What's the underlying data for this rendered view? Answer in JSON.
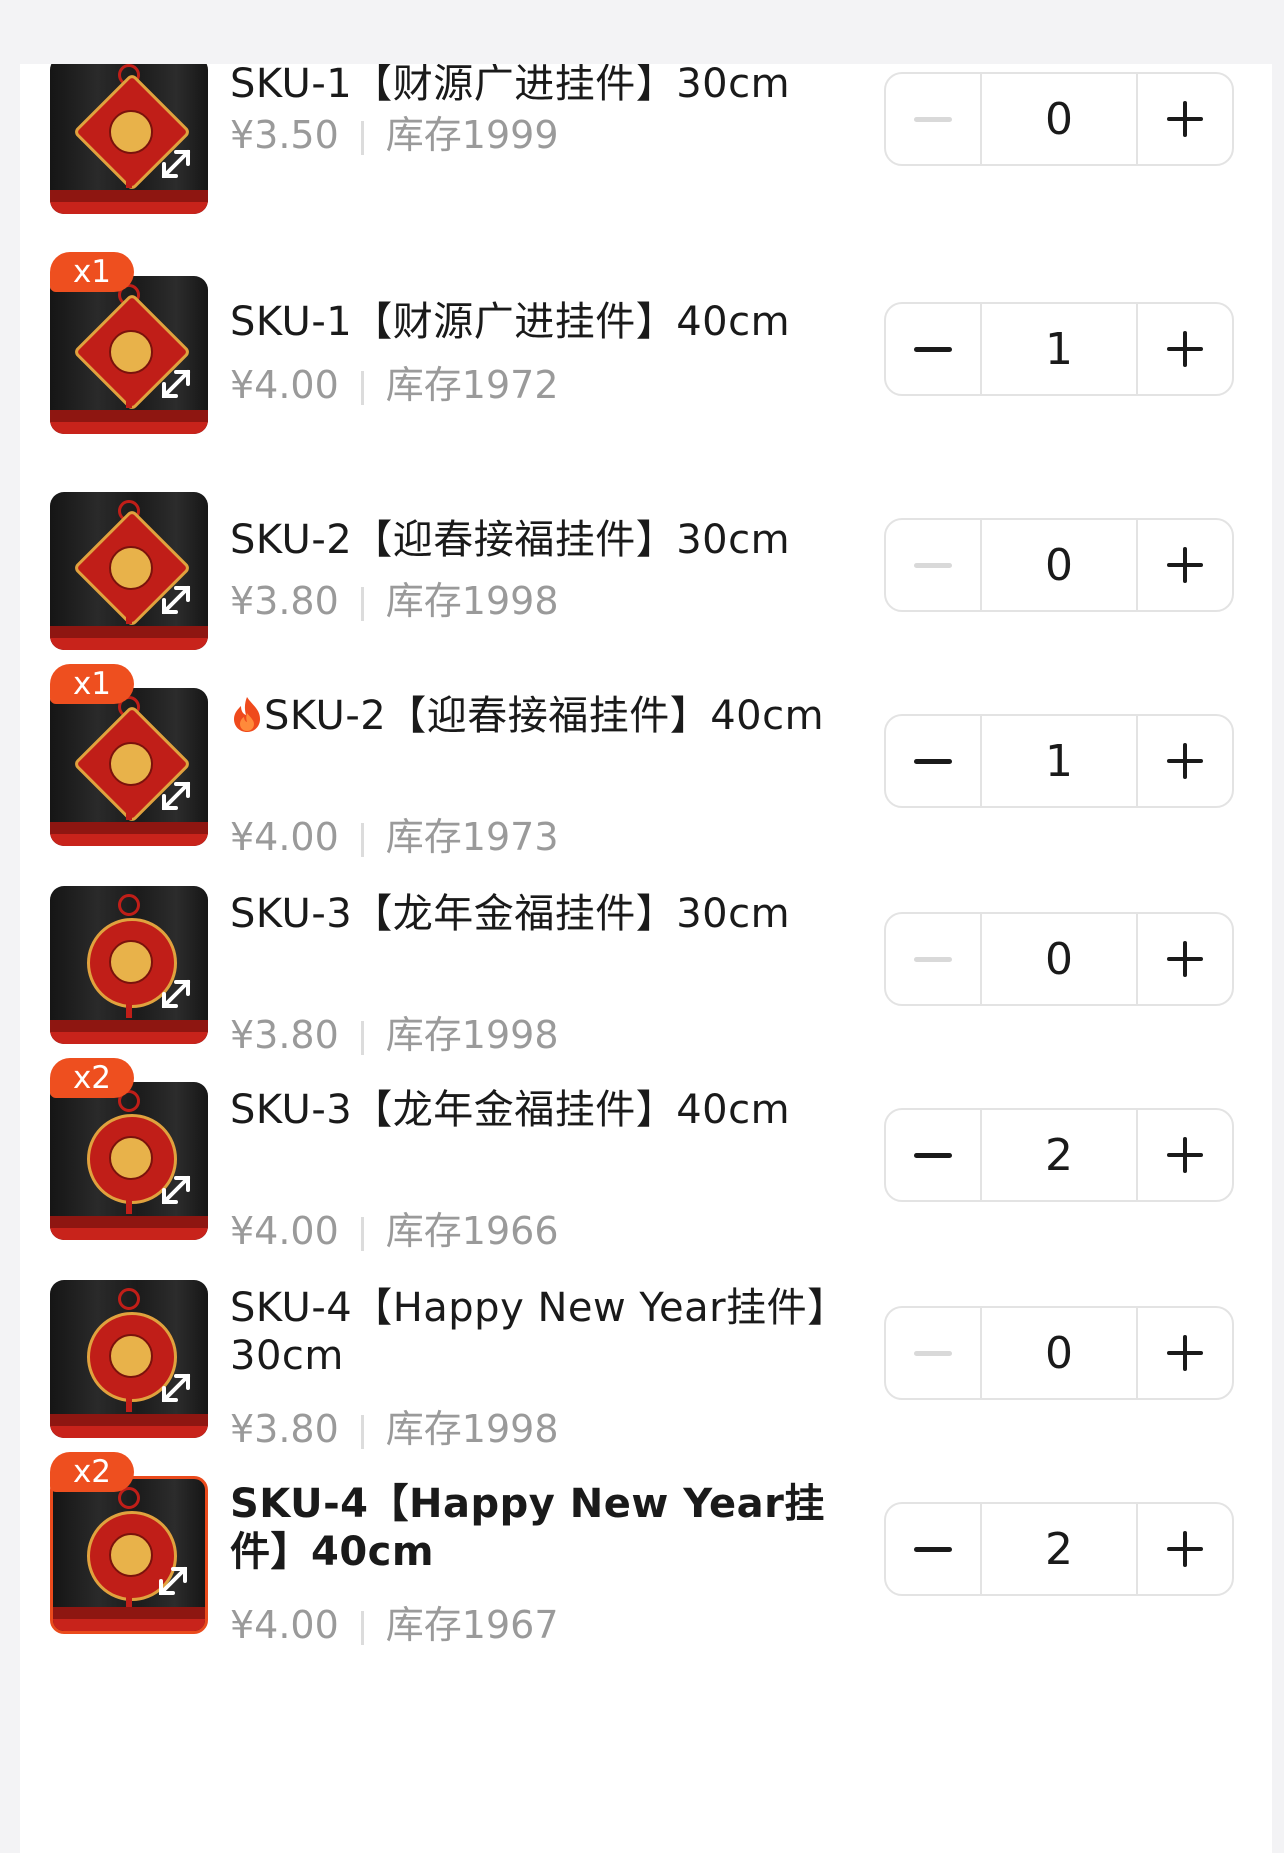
{
  "items": [
    {
      "title": "SKU-1【财源广进挂件】30cm",
      "price": "¥3.50",
      "stock": "库存1999",
      "qty": "0",
      "badge": "",
      "hot": false,
      "style": "diamond",
      "selected": false
    },
    {
      "title": "SKU-1【财源广进挂件】40cm",
      "price": "¥4.00",
      "stock": "库存1972",
      "qty": "1",
      "badge": "x1",
      "hot": false,
      "style": "diamond",
      "selected": false
    },
    {
      "title": "SKU-2【迎春接福挂件】30cm",
      "price": "¥3.80",
      "stock": "库存1998",
      "qty": "0",
      "badge": "",
      "hot": false,
      "style": "diamond",
      "selected": false
    },
    {
      "title": "SKU-2【迎春接福挂件】40cm",
      "price": "¥4.00",
      "stock": "库存1973",
      "qty": "1",
      "badge": "x1",
      "hot": true,
      "style": "diamond",
      "selected": false
    },
    {
      "title": "SKU-3【龙年金福挂件】30cm",
      "price": "¥3.80",
      "stock": "库存1998",
      "qty": "0",
      "badge": "",
      "hot": false,
      "style": "round",
      "selected": false
    },
    {
      "title": "SKU-3【龙年金福挂件】40cm",
      "price": "¥4.00",
      "stock": "库存1966",
      "qty": "2",
      "badge": "x2",
      "hot": false,
      "style": "round",
      "selected": false
    },
    {
      "title": "SKU-4【Happy New Year挂件】30cm",
      "price": "¥3.80",
      "stock": "库存1998",
      "qty": "0",
      "badge": "",
      "hot": false,
      "style": "round",
      "selected": false
    },
    {
      "title": "SKU-4【Happy New Year挂件】40cm",
      "price": "¥4.00",
      "stock": "库存1967",
      "qty": "2",
      "badge": "x2",
      "hot": false,
      "style": "round",
      "selected": true
    }
  ],
  "icons": {
    "expand": "expand-icon",
    "minus": "minus-icon",
    "plus": "plus-icon",
    "hot": "fire-icon"
  },
  "colors": {
    "accent": "#ee4f1f",
    "disabled": "#d9d9d9",
    "muted": "#9a9a9a"
  }
}
